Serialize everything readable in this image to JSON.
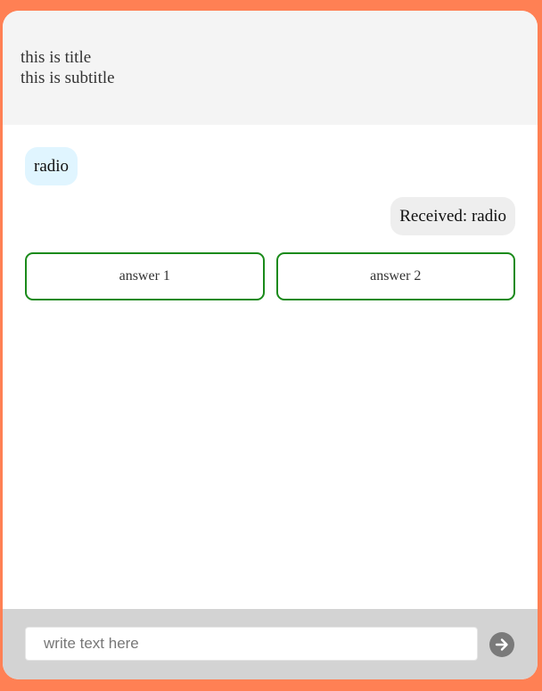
{
  "header": {
    "title": "this is title",
    "subtitle": "this is subtitle"
  },
  "messages": [
    {
      "direction": "incoming",
      "text": "radio"
    },
    {
      "direction": "outgoing",
      "text": "Received: radio"
    }
  ],
  "answers": [
    {
      "label": "answer 1"
    },
    {
      "label": "answer 2"
    }
  ],
  "composer": {
    "placeholder": "write text here",
    "value": "",
    "send_icon": "arrow-right-circle-icon"
  },
  "colors": {
    "frame_border": "#ff8054",
    "header_bg": "#f4f4f4",
    "incoming_bubble": "#e0f5ff",
    "outgoing_bubble": "#eeeeee",
    "answer_border": "#1a8a1a",
    "footer_bg": "#d3d3d3",
    "send_button": "#7a7a7a"
  }
}
